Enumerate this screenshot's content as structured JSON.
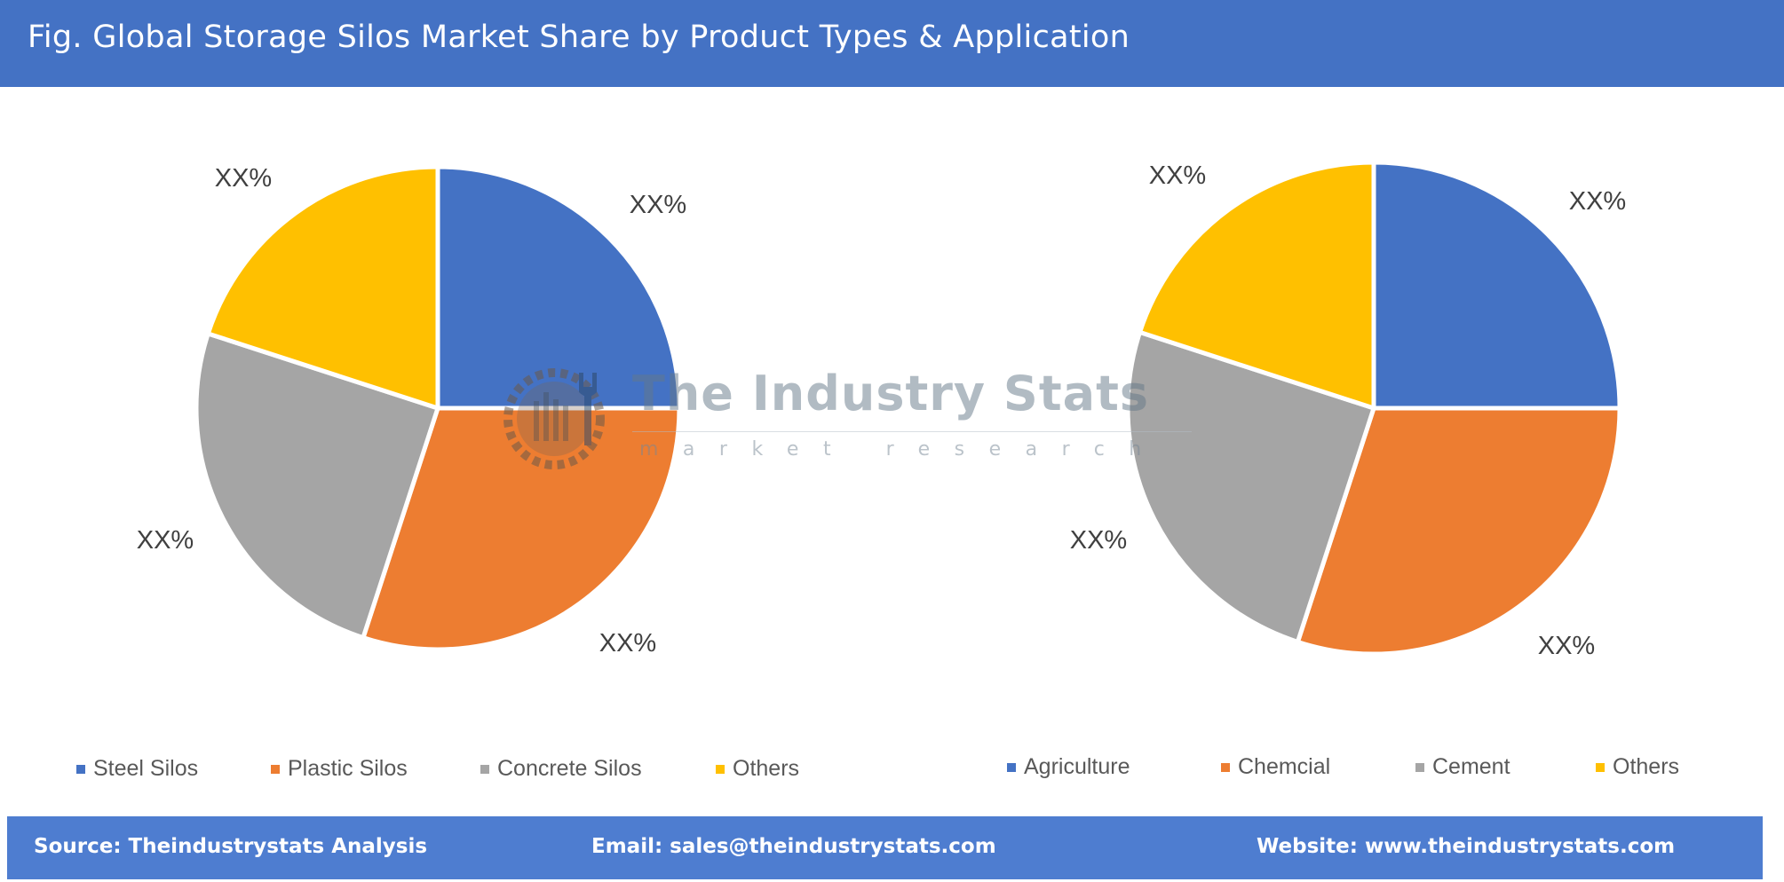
{
  "header": {
    "title": "Fig. Global Storage Silos Market Share by Product Types & Application"
  },
  "watermark": {
    "title": "The Industry Stats",
    "subtitle": "market research"
  },
  "colors": {
    "header_bg": "#4472c4",
    "footer_bg": "#4e7dd0",
    "series": [
      "#4472c4",
      "#ed7d31",
      "#a5a5a5",
      "#ffc000"
    ]
  },
  "chart_data": [
    {
      "type": "pie",
      "title": "Product Types",
      "categories": [
        "Steel Silos",
        "Plastic Silos",
        "Concrete Silos",
        "Others"
      ],
      "values": [
        25,
        30,
        25,
        20
      ],
      "data_labels": [
        "XX%",
        "XX%",
        "XX%",
        "XX%"
      ],
      "colors": [
        "#4472c4",
        "#ed7d31",
        "#a5a5a5",
        "#ffc000"
      ],
      "start_angle_deg": 0,
      "direction": "clockwise",
      "legend": "bottom"
    },
    {
      "type": "pie",
      "title": "Application",
      "categories": [
        "Agriculture",
        "Chemcial",
        "Cement",
        "Others"
      ],
      "values": [
        25,
        30,
        25,
        20
      ],
      "data_labels": [
        "XX%",
        "XX%",
        "XX%",
        "XX%"
      ],
      "colors": [
        "#4472c4",
        "#ed7d31",
        "#a5a5a5",
        "#ffc000"
      ],
      "start_angle_deg": 0,
      "direction": "clockwise",
      "legend": "bottom"
    }
  ],
  "footer": {
    "source": "Source: Theindustrystats Analysis",
    "email": "Email: sales@theindustrystats.com",
    "website": "Website: www.theindustrystats.com"
  }
}
